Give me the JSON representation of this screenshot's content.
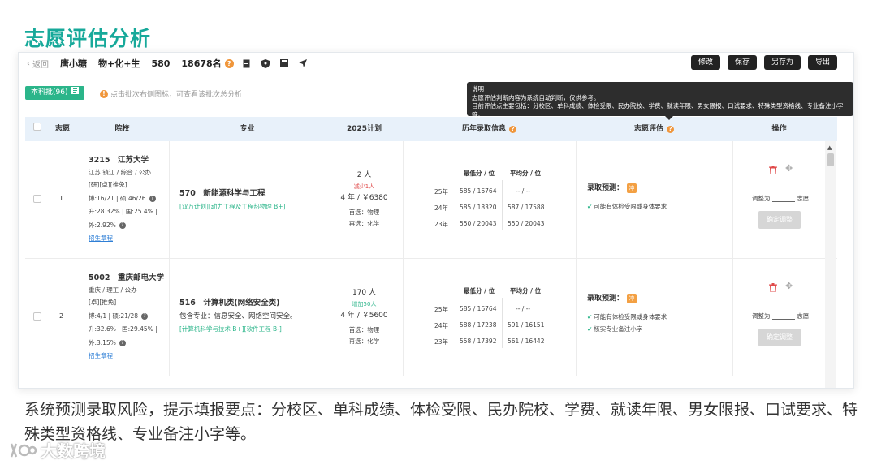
{
  "page_title": "志愿评估分析",
  "toolbar": {
    "back_label": "返回",
    "student_name": "唐小糖",
    "subjects": "物+化+生",
    "score": "580",
    "rank": "18678名",
    "rank_help": "?",
    "icons": [
      "document-icon",
      "shield-icon",
      "save-box-icon",
      "send-icon"
    ],
    "buttons": [
      "修改",
      "保存",
      "另存为",
      "导出"
    ]
  },
  "batch": {
    "label": "本科批(96)",
    "hint_icon": "!",
    "hint": "点击批次右侧图标，可查看该批次总分析"
  },
  "tooltip": {
    "title": "说明",
    "line1": "志愿评估判断内容为系统自动判断，仅供参考。",
    "line2": "目前评估点主要包括：分校区、单科成绩、体检受限、民办院校、学费、就读年限、男女限报、口试要求、特殊类型资格线、专业备注小字等。"
  },
  "table": {
    "headers": {
      "select_all": "",
      "order": "志愿",
      "school": "院校",
      "major": "专业",
      "plan": "2025计划",
      "history": "历年录取信息",
      "evaluation": "志愿评估",
      "action": "操作"
    },
    "rows": [
      {
        "order": "1",
        "school": {
          "code_name": "3215　江苏大学",
          "location": "江苏 镇江 / 综合 / 公办",
          "tags": "[研][卓][推免]",
          "stat1": "博:16/21 | 硕:46/26",
          "stat2": "升:28.32% | 国:25.4% |",
          "stat3": "外:2.92%",
          "link": "招生章程"
        },
        "major": {
          "name": "570　新能源科学与工程",
          "desc": "",
          "tags": "[双万计划][动力工程及工程热物理 B+]"
        },
        "plan": {
          "count": "2 人",
          "change": "减少1人",
          "change_type": "decrease",
          "duration_fee": "4 年 / ￥6380",
          "first": "首选：物理",
          "second": "再选：化学"
        },
        "history": {
          "h_low": "最低分 / 位",
          "h_avg": "平均分 / 位",
          "rows": [
            {
              "year": "25年",
              "low": "585 / 16764",
              "avg": "-- / --"
            },
            {
              "year": "24年",
              "low": "585 / 18320",
              "avg": "587 / 17588"
            },
            {
              "year": "23年",
              "low": "550 / 20043",
              "avg": "550 / 20043"
            }
          ]
        },
        "evaluation": {
          "label": "录取预测：",
          "badge": "冲",
          "notes": [
            "可能有体检受限或身体要求"
          ]
        },
        "action": {
          "adjust_prefix": "调整为",
          "adjust_suffix": "志愿",
          "confirm": "确定调整"
        }
      },
      {
        "order": "2",
        "school": {
          "code_name": "5002　重庆邮电大学",
          "location": "重庆 / 理工 / 公办",
          "tags": "[卓][推免]",
          "stat1": "博:4/1 | 硕:21/28",
          "stat2": "升:32.6% | 国:29.45% |",
          "stat3": "外:3.15%",
          "link": "招生章程"
        },
        "major": {
          "name": "516　计算机类(网络安全类)",
          "desc": "包含专业：信息安全、网络空间安全。",
          "tags": "[计算机科学与技术 B+][软件工程 B-]"
        },
        "plan": {
          "count": "170 人",
          "change": "增加50人",
          "change_type": "increase",
          "duration_fee": "4 年 / ￥5600",
          "first": "首选：物理",
          "second": "再选：化学"
        },
        "history": {
          "h_low": "最低分 / 位",
          "h_avg": "平均分 / 位",
          "rows": [
            {
              "year": "25年",
              "low": "585 / 16764",
              "avg": "-- / --"
            },
            {
              "year": "24年",
              "low": "588 / 17238",
              "avg": "591 / 16151"
            },
            {
              "year": "23年",
              "low": "558 / 17392",
              "avg": "561 / 16442"
            }
          ]
        },
        "evaluation": {
          "label": "录取预测：",
          "badge": "冲",
          "notes": [
            "可能有体检受限或身体要求",
            "核实专业备注小字"
          ]
        },
        "action": {
          "adjust_prefix": "调整为",
          "adjust_suffix": "志愿",
          "confirm": "确定调整"
        }
      }
    ]
  },
  "caption": "系统预测录取风险，提示填报要点：分校区、单科成绩、体检受限、民办院校、学费、就读年限、男女限报、口试要求、特殊类型资格线、专业备注小字等。",
  "watermark": "大数跨境",
  "colors": {
    "brand": "#17a99a",
    "accent": "#f0963b",
    "green": "#2bb58a",
    "header_bg": "#e8f1fa"
  }
}
